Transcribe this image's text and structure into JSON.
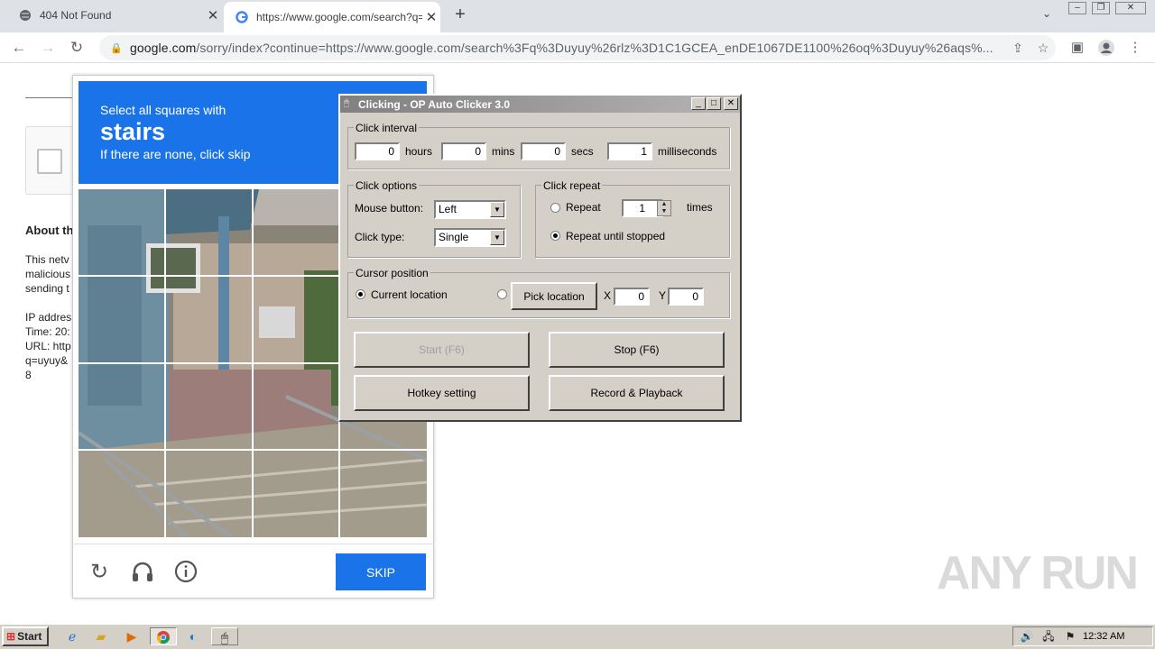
{
  "browser": {
    "tabs": [
      {
        "title": "404 Not Found",
        "icon": "globe-icon"
      },
      {
        "title": "https://www.google.com/search?q=",
        "icon": "google-icon"
      }
    ],
    "url_host": "google.com",
    "url_rest": "/sorry/index?continue=https://www.google.com/search%3Fq%3Duyuy%26rlz%3D1C1GCEA_enDE1067DE1100%26oq%3Duyuy%26aqs%..."
  },
  "page": {
    "about_heading": "About th",
    "lines": [
      "This netv",
      "malicious",
      "sending t",
      "",
      "IP addres",
      "Time: 20:",
      "URL: http",
      "q=uyuy&",
      "8"
    ]
  },
  "captcha": {
    "line1": "Select all squares with",
    "keyword": "stairs",
    "line3": "If there are none, click skip",
    "skip_label": "SKIP"
  },
  "clicker": {
    "title": "Clicking - OP Auto Clicker 3.0",
    "interval_label": "Click interval",
    "hours": "0",
    "hours_label": "hours",
    "mins": "0",
    "mins_label": "mins",
    "secs": "0",
    "secs_label": "secs",
    "ms": "1",
    "ms_label": "milliseconds",
    "options_label": "Click options",
    "mouse_button_label": "Mouse button:",
    "mouse_button": "Left",
    "click_type_label": "Click type:",
    "click_type": "Single",
    "repeat_label": "Click repeat",
    "repeat_option": "Repeat",
    "repeat_times": "1",
    "times_label": "times",
    "repeat_until": "Repeat until stopped",
    "cursor_label": "Cursor position",
    "current_location": "Current location",
    "pick_location": "Pick location",
    "x_label": "X",
    "x_value": "0",
    "y_label": "Y",
    "y_value": "0",
    "start": "Start (F6)",
    "stop": "Stop (F6)",
    "hotkey": "Hotkey setting",
    "record": "Record & Playback"
  },
  "taskbar": {
    "start": "Start",
    "clock": "12:32 AM"
  },
  "watermark": "ANY RUN"
}
